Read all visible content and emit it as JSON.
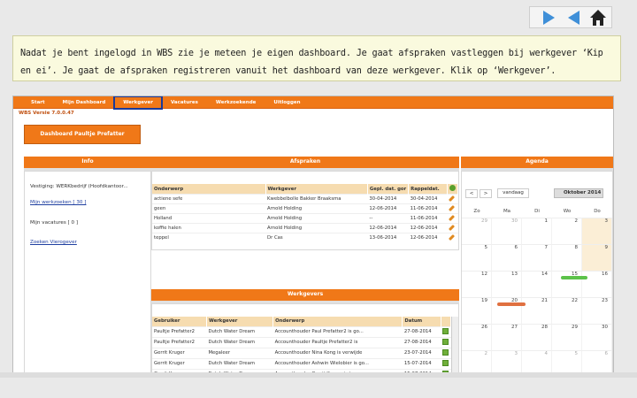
{
  "player": {
    "next": "next-slide",
    "prev": "previous-slide",
    "home": "home"
  },
  "instruction": "Nadat je bent ingelogd in WBS zie je meteen je eigen dashboard. Je gaat afspraken vastleggen bij werkgever ‘Kip en ei’. Je gaat de afspraken registreren vanuit het dashboard van deze werkgever. Klik op ‘Werkgever’.",
  "app": {
    "menu": [
      "Start",
      "Mijn Dashboard",
      "Werkgever",
      "Vacatures",
      "Werkzoekende",
      "Uitloggen"
    ],
    "version": "WBS Versie 7.0.0.47",
    "dashboard_button": "Dashboard Paultje Prefatter",
    "info": {
      "title": "Info",
      "vestiging": "Vestiging: WERKbedrijf (Hoofdkantoor...",
      "werkzoekenden": "Mijn werkzoeken [ 30 ]",
      "vacatures": "Mijn vacatures [ 0 ]",
      "zoeken": "Zoeken Vierogever"
    },
    "afspraken": {
      "title": "Afspraken",
      "headers": [
        "Onderwerp",
        "Werkgever",
        "Gepl. dat. gor",
        "Rappeldat."
      ],
      "rows": [
        [
          "actiene sefe",
          "Kwebbelbolle Bakker Braaksma",
          "30-04-2014",
          "30-04-2014"
        ],
        [
          "geen",
          "Arnold Holding",
          "12-06-2014",
          "11-06-2014"
        ],
        [
          "Holland",
          "Arnold Holding",
          "--",
          "11-06-2014"
        ],
        [
          "koffie halen",
          "Arnold Holding",
          "12-06-2014",
          "12-06-2014"
        ],
        [
          "teppel",
          "Dr Cas",
          "13-06-2014",
          "12-06-2014"
        ]
      ]
    },
    "werkgevers": {
      "title": "Werkgevers",
      "headers": [
        "Gebruiker",
        "Werkgever",
        "Onderwerp",
        "Datum"
      ],
      "rows": [
        [
          "Paultje Prefatter2",
          "Dutch Water Dream",
          "Accounthouder Paul Prefatter2 is go...",
          "27-08-2014"
        ],
        [
          "Paultje Prefatter2",
          "Dutch Water Dream",
          "Accounthouder Paultje Prefatter2 is",
          "27-08-2014"
        ],
        [
          "Gerrit Kruger",
          "Megaleer",
          "Accounthouder Nina Kong is verwijde",
          "23-07-2014"
        ],
        [
          "Gerrit Kruger",
          "Dutch Water Dream",
          "Accounthouder Ashwin Wielobier is go...",
          "15-07-2014"
        ],
        [
          "Gerrit Kruger",
          "Dutch Water Dream",
          "Accounthouder Gerrit Kruger is toeg...",
          "15-07-2014"
        ]
      ]
    },
    "agenda": {
      "title": "Agenda",
      "today": "vandaag",
      "month": "Oktober 2014",
      "weekdays": [
        "Zo",
        "Ma",
        "Di",
        "Wo",
        "Do"
      ],
      "weeks": [
        [
          "29",
          "30",
          "1",
          "2",
          "3"
        ],
        [
          "5",
          "6",
          "7",
          "8",
          "9"
        ],
        [
          "12",
          "13",
          "14",
          "15",
          "16"
        ],
        [
          "19",
          "20",
          "21",
          "22",
          "23"
        ],
        [
          "26",
          "27",
          "28",
          "29",
          "30"
        ],
        [
          "2",
          "3",
          "4",
          "5",
          "6"
        ]
      ]
    }
  },
  "colors": {
    "accent": "#f07818",
    "highlight": "#1a3a9a",
    "instruction_bg": "#fafade",
    "event_green": "#5cc24a",
    "event_orange": "#e07040"
  }
}
